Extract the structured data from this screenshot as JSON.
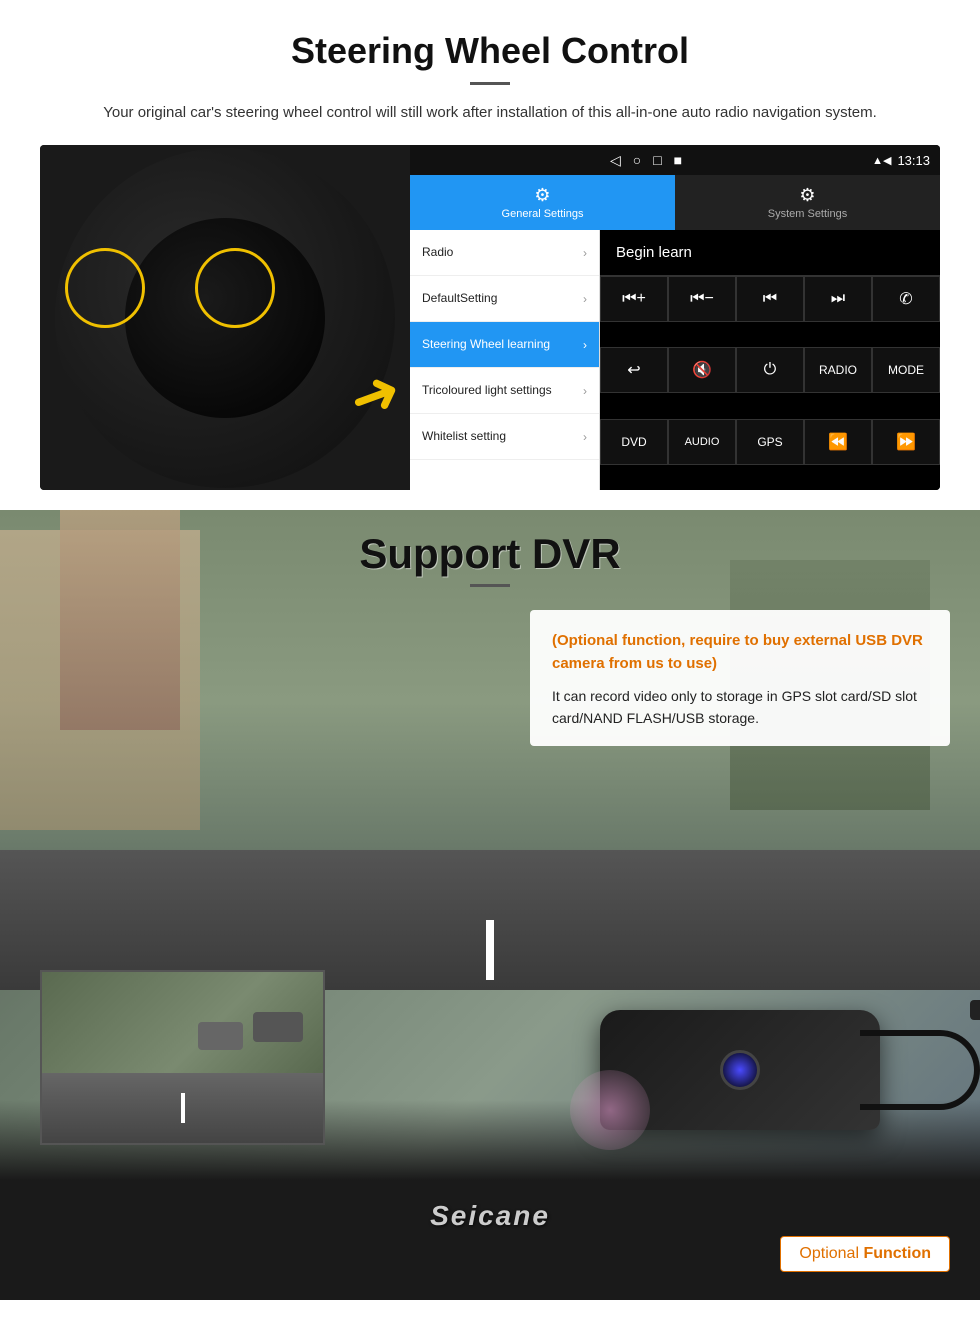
{
  "steering": {
    "title": "Steering Wheel Control",
    "subtitle": "Your original car's steering wheel control will still work after installation of this all-in-one auto radio navigation system.",
    "statusBar": {
      "navIcons": [
        "◁",
        "○",
        "□",
        "■"
      ],
      "signalIcons": "▲ ◀",
      "time": "13:13"
    },
    "tabs": [
      {
        "icon": "⚙",
        "label": "General Settings",
        "active": true
      },
      {
        "icon": "⚙",
        "label": "System Settings",
        "active": false
      }
    ],
    "menuItems": [
      {
        "text": "Radio",
        "active": false
      },
      {
        "text": "DefaultSetting",
        "active": false
      },
      {
        "text": "Steering Wheel learning",
        "active": true
      },
      {
        "text": "Tricoloured light settings",
        "active": false
      },
      {
        "text": "Whitelist setting",
        "active": false
      }
    ],
    "beginLearn": "Begin learn",
    "controlButtons": [
      {
        "label": "⏮+",
        "row": 1
      },
      {
        "label": "⏮-",
        "row": 1
      },
      {
        "label": "⏮",
        "row": 1
      },
      {
        "label": "⏭",
        "row": 1
      },
      {
        "label": "✆",
        "row": 1
      },
      {
        "label": "↩",
        "row": 2
      },
      {
        "label": "🔇",
        "row": 2
      },
      {
        "label": "⏻",
        "row": 2
      },
      {
        "label": "RADIO",
        "row": 2
      },
      {
        "label": "MODE",
        "row": 2
      },
      {
        "label": "DVD",
        "row": 3
      },
      {
        "label": "AUDIO",
        "row": 3
      },
      {
        "label": "GPS",
        "row": 3
      },
      {
        "label": "⏪",
        "row": 3
      },
      {
        "label": "⏩",
        "row": 3
      }
    ]
  },
  "dvr": {
    "title": "Support DVR",
    "optionalNote": "(Optional function, require to buy external USB DVR camera from us to use)",
    "description": "It can record video only to storage in GPS slot card/SD slot card/NAND FLASH/USB storage.",
    "optionalBadge": {
      "optional": "Optional",
      "function": "Function"
    },
    "brandName": "Seicane"
  }
}
